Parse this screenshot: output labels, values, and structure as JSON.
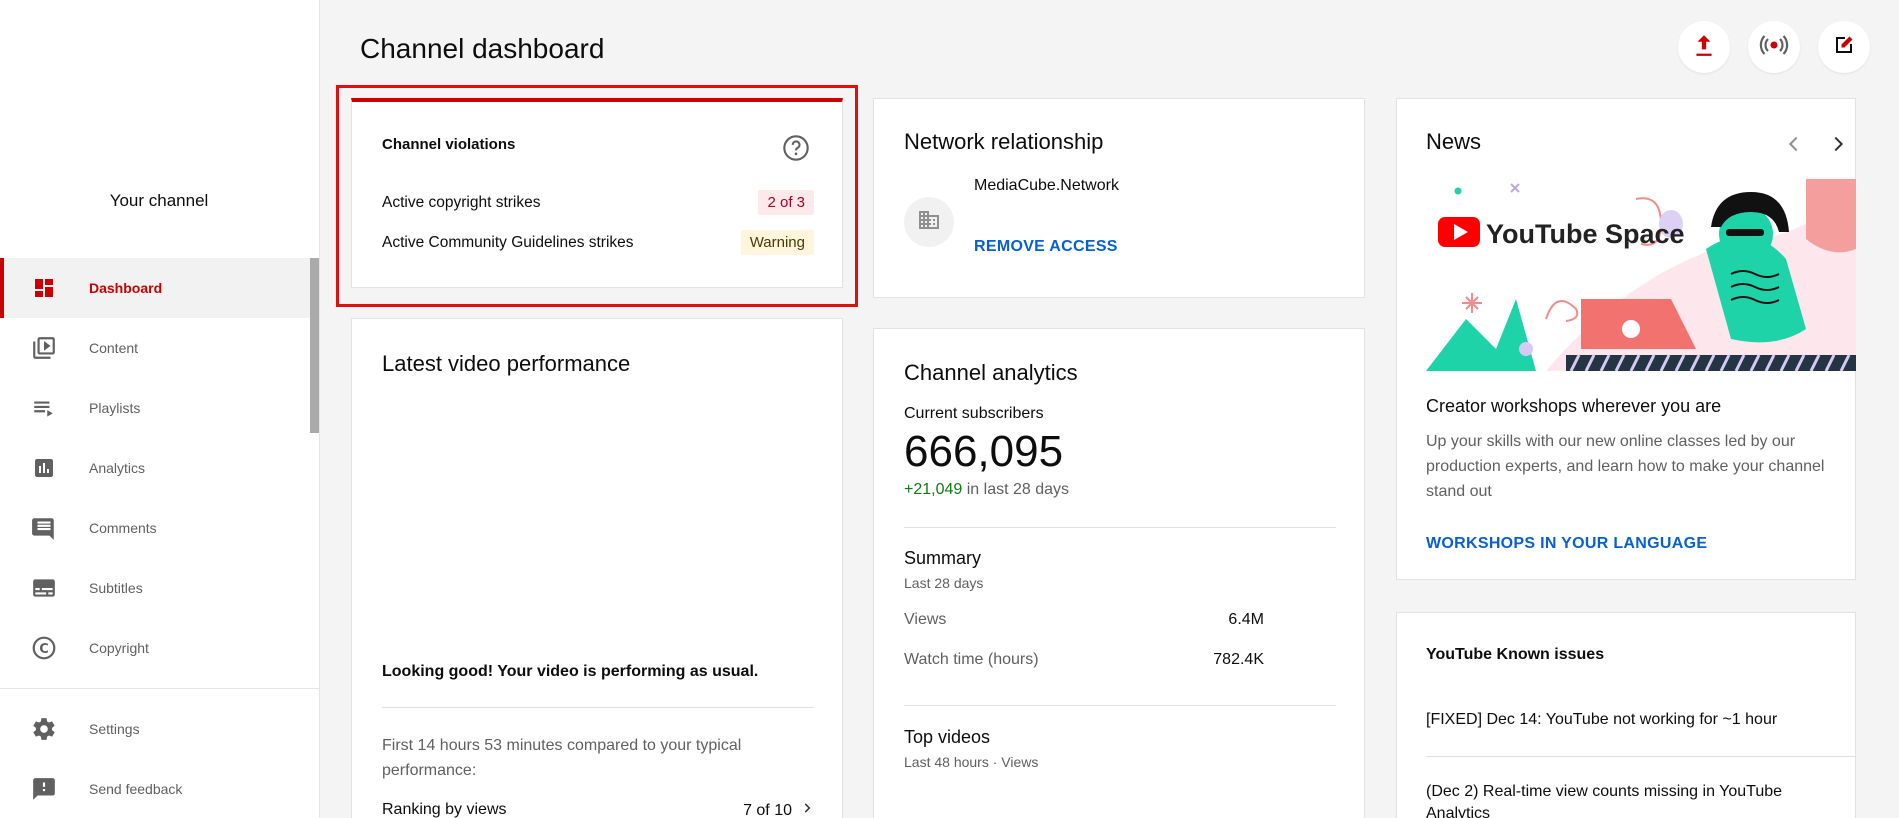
{
  "sidebar": {
    "channel_name": "Your channel",
    "items": [
      {
        "label": "Dashboard",
        "icon": "dashboard-icon",
        "active": true
      },
      {
        "label": "Content",
        "icon": "video-library-icon"
      },
      {
        "label": "Playlists",
        "icon": "playlist-icon"
      },
      {
        "label": "Analytics",
        "icon": "analytics-icon"
      },
      {
        "label": "Comments",
        "icon": "comment-icon"
      },
      {
        "label": "Subtitles",
        "icon": "subtitles-icon"
      },
      {
        "label": "Copyright",
        "icon": "copyright-icon"
      }
    ],
    "bottom_items": [
      {
        "label": "Settings",
        "icon": "gear-icon"
      },
      {
        "label": "Send feedback",
        "icon": "feedback-icon"
      }
    ]
  },
  "header": {
    "title": "Channel dashboard",
    "buttons": [
      "upload-icon",
      "live-icon",
      "create-post-icon"
    ]
  },
  "violations": {
    "title": "Channel violations",
    "rows": [
      {
        "label": "Active copyright strikes",
        "badge": "2 of 3"
      },
      {
        "label": "Active Community Guidelines strikes",
        "badge": "Warning"
      }
    ]
  },
  "network": {
    "title": "Network relationship",
    "name": "MediaCube.Network",
    "action": "REMOVE ACCESS"
  },
  "news": {
    "title": "News",
    "image_text": "YouTube Space",
    "headline": "Creator workshops wherever you are",
    "body": "Up your skills with our new online classes led by our production experts, and learn how to make your channel stand out",
    "link": "WORKSHOPS IN YOUR LANGUAGE"
  },
  "latest": {
    "title": "Latest video performance",
    "status": "Looking good! Your video is performing as usual.",
    "compare": "First 14 hours 53 minutes compared to your typical performance:",
    "ranking_label": "Ranking by views",
    "ranking_value": "7 of 10"
  },
  "analytics": {
    "title": "Channel analytics",
    "subs_label": "Current subscribers",
    "subs_value": "666,095",
    "change_value": "+21,049",
    "change_period": "in last 28 days",
    "summary_title": "Summary",
    "summary_period": "Last 28 days",
    "views_label": "Views",
    "views_value": "6.4M",
    "watch_label": "Watch time (hours)",
    "watch_value": "782.4K",
    "top_title": "Top videos",
    "top_period": "Last 48 hours · Views"
  },
  "known": {
    "title": "YouTube Known issues",
    "items": [
      "[FIXED] Dec 14: YouTube not working for ~1 hour",
      "(Dec 2) Real-time view counts missing in YouTube Analytics"
    ]
  },
  "colors": {
    "accent": "#cc0000",
    "link": "#065fd4",
    "positive": "#0f7b0f",
    "highlight": "#e10e0e"
  }
}
